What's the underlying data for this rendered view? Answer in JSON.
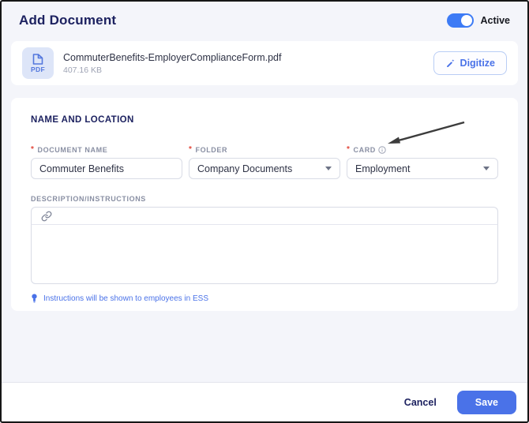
{
  "header": {
    "title": "Add Document",
    "toggle_label": "Active",
    "toggle_state": "on"
  },
  "file": {
    "icon_label": "PDF",
    "name": "CommuterBenefits-EmployerComplianceForm.pdf",
    "size": "407.16 KB",
    "digitize_label": "Digitize"
  },
  "form": {
    "section_title": "NAME AND LOCATION",
    "fields": {
      "document_name": {
        "label": "Document Name",
        "required": "*",
        "value": "Commuter Benefits"
      },
      "folder": {
        "label": "Folder",
        "required": "*",
        "value": "Company Documents"
      },
      "card": {
        "label": "Card",
        "required": "*",
        "value": "Employment"
      }
    },
    "description": {
      "label": "Description/Instructions",
      "value": "",
      "placeholder": ""
    },
    "hint": "Instructions will be shown to employees in ESS"
  },
  "footer": {
    "cancel_label": "Cancel",
    "save_label": "Save"
  },
  "colors": {
    "accent_blue": "#4a72e8",
    "toggle_blue": "#3d7bf5",
    "navy_text": "#1d2260",
    "label_gray": "#898fa3",
    "required_red": "#e2493d",
    "card_bg": "#ffffff",
    "page_bg": "#f4f5fa",
    "pdf_tile_bg": "#dde5f8"
  }
}
